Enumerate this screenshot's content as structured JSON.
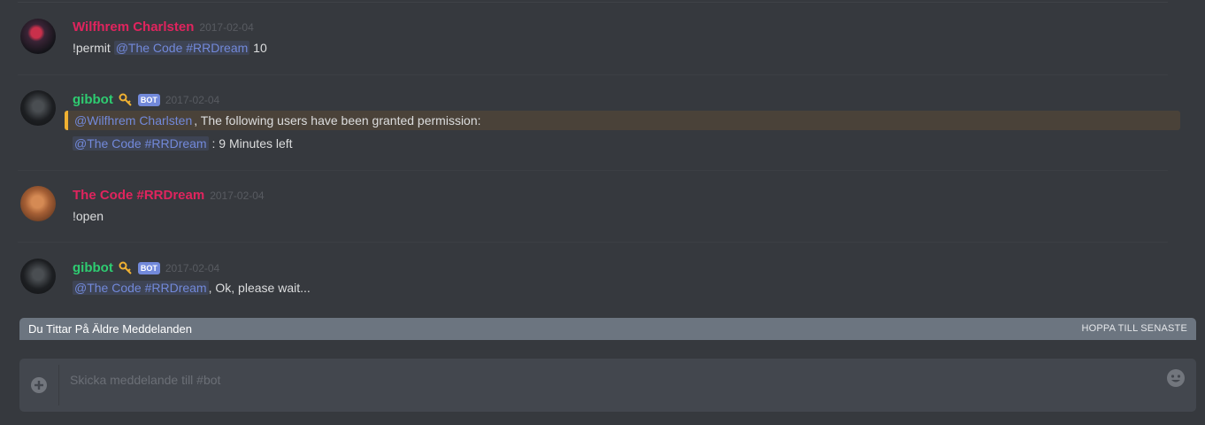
{
  "messages": [
    {
      "username": "Wilfhrem Charlsten",
      "timestamp": "2017-02-04",
      "text_prefix": "!permit ",
      "mention": "@The Code #RRDream",
      "text_suffix": " 10"
    },
    {
      "username": "gibbot",
      "bot_tag": "BOT",
      "timestamp": "2017-02-04",
      "embed_mention": "@Wilfhrem Charlsten",
      "embed_text": ", The following users have been granted permission:",
      "line2_mention": "@The Code #RRDream",
      "line2_text": " : 9 Minutes left"
    },
    {
      "username": "The Code #RRDream",
      "timestamp": "2017-02-04",
      "text": "!open"
    },
    {
      "username": "gibbot",
      "bot_tag": "BOT",
      "timestamp": "2017-02-04",
      "mention": "@The Code #RRDream",
      "text_suffix": ", Ok, please wait..."
    }
  ],
  "older_banner": {
    "text": "Du Tittar På Äldre Meddelanden",
    "jump_label": "HOPPA TILL SENASTE"
  },
  "composer": {
    "placeholder": "Skicka meddelande till #bot"
  },
  "colors": {
    "background": "#36393e",
    "username_red": "#e0245e",
    "username_green": "#2ecc71",
    "mention": "#7289da",
    "embed_accent": "#f0b132"
  }
}
